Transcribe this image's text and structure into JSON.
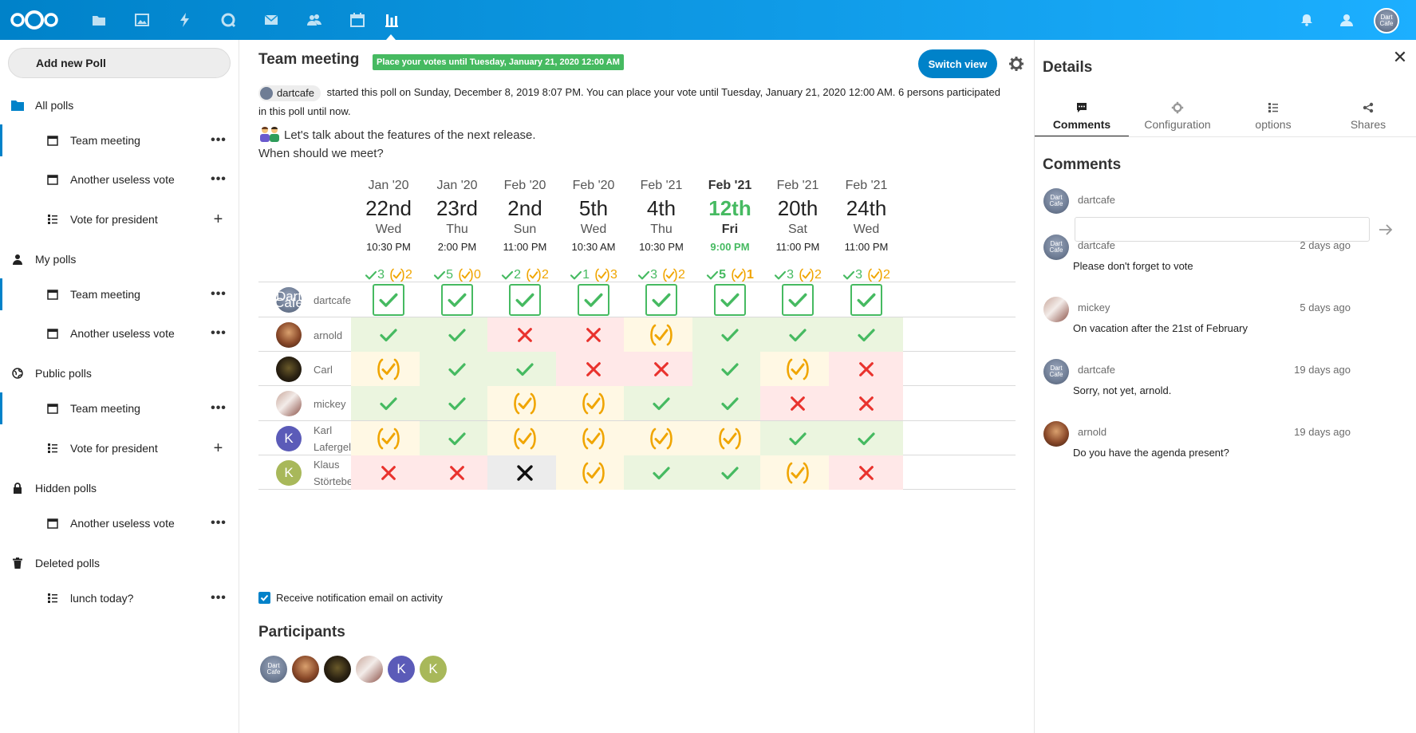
{
  "header": {
    "app_icons": [
      "files-icon",
      "photos-icon",
      "activity-icon",
      "talk-icon",
      "mail-icon",
      "contacts-icon",
      "calendar-icon",
      "polls-icon"
    ],
    "right_icons": [
      "notifications-icon",
      "contacts-menu-icon"
    ]
  },
  "sidebar": {
    "add_label": "Add new Poll",
    "groups": {
      "all": "All polls",
      "my": "My polls",
      "public": "Public polls",
      "hidden": "Hidden polls",
      "deleted": "Deleted polls"
    },
    "items": [
      {
        "label": "Team meeting",
        "icon": "calendar-icon",
        "action": "more"
      },
      {
        "label": "Another useless vote",
        "icon": "calendar-icon",
        "action": "more"
      },
      {
        "label": "Vote for president",
        "icon": "list-icon",
        "action": "add"
      },
      {
        "label": "Team meeting",
        "icon": "calendar-icon",
        "action": "more"
      },
      {
        "label": "Another useless vote",
        "icon": "calendar-icon",
        "action": "more"
      },
      {
        "label": "Team meeting",
        "icon": "calendar-icon",
        "action": "more"
      },
      {
        "label": "Vote for president",
        "icon": "list-icon",
        "action": "add"
      },
      {
        "label": "Another useless vote",
        "icon": "calendar-icon",
        "action": "more"
      },
      {
        "label": "lunch today?",
        "icon": "list-icon",
        "action": "more"
      }
    ]
  },
  "main": {
    "title": "Team meeting",
    "expire_badge": "Place your votes until Tuesday, January 21, 2020 12:00 AM",
    "switch_view": "Switch view",
    "owner": "dartcafe",
    "info_text": "started this poll on Sunday, December 8, 2019 8:07 PM. You can place your vote until Tuesday, January 21, 2020 12:00 AM. 6 persons participated in this poll until now.",
    "desc_line1": "Let's talk about the features of the next release.",
    "desc_line2": "When should we meet?",
    "notify_label": "Receive notification email on activity",
    "participants_title": "Participants"
  },
  "options": [
    {
      "month": "Jan '20",
      "day": "22nd",
      "dow": "Wed",
      "time": "10:30 PM",
      "yes": "3",
      "maybe": "2",
      "best": false
    },
    {
      "month": "Jan '20",
      "day": "23rd",
      "dow": "Thu",
      "time": "2:00 PM",
      "yes": "5",
      "maybe": "0",
      "best": false
    },
    {
      "month": "Feb '20",
      "day": "2nd",
      "dow": "Sun",
      "time": "11:00 PM",
      "yes": "2",
      "maybe": "2",
      "best": false
    },
    {
      "month": "Feb '20",
      "day": "5th",
      "dow": "Wed",
      "time": "10:30 AM",
      "yes": "1",
      "maybe": "3",
      "best": false
    },
    {
      "month": "Feb '21",
      "day": "4th",
      "dow": "Thu",
      "time": "10:30 PM",
      "yes": "3",
      "maybe": "2",
      "best": false
    },
    {
      "month": "Feb '21",
      "day": "12th",
      "dow": "Fri",
      "time": "9:00 PM",
      "yes": "5",
      "maybe": "1",
      "best": true
    },
    {
      "month": "Feb '21",
      "day": "20th",
      "dow": "Sat",
      "time": "11:00 PM",
      "yes": "3",
      "maybe": "2",
      "best": false
    },
    {
      "month": "Feb '21",
      "day": "24th",
      "dow": "Wed",
      "time": "11:00 PM",
      "yes": "3",
      "maybe": "2",
      "best": false
    }
  ],
  "participants": [
    {
      "name": "dartcafe",
      "avatar": "dart",
      "avatar_text": "Dart Cafe",
      "votes": [
        "box",
        "box",
        "box",
        "box",
        "box",
        "box",
        "box",
        "box"
      ]
    },
    {
      "name": "arnold",
      "avatar": "photo-a",
      "votes": [
        "yes",
        "yes",
        "no",
        "no",
        "maybe",
        "yes",
        "yes",
        "yes"
      ]
    },
    {
      "name": "Carl",
      "avatar": "photo-c",
      "votes": [
        "maybe",
        "yes",
        "yes",
        "no",
        "no",
        "yes",
        "maybe",
        "no"
      ]
    },
    {
      "name": "mickey",
      "avatar": "photo-m",
      "votes": [
        "yes",
        "yes",
        "maybe",
        "maybe",
        "yes",
        "yes",
        "no",
        "no"
      ]
    },
    {
      "name": "Karl Lafergeld",
      "avatar": "letter",
      "letter": "K",
      "color": "#5b5bb8",
      "votes": [
        "maybe",
        "yes",
        "maybe",
        "maybe",
        "maybe",
        "maybe",
        "yes",
        "yes"
      ]
    },
    {
      "name": "Klaus Störtebecker",
      "avatar": "letter",
      "letter": "K",
      "color": "#a8b85a",
      "votes": [
        "no",
        "no",
        "none",
        "maybe",
        "yes",
        "yes",
        "maybe",
        "no"
      ]
    }
  ],
  "details": {
    "title": "Details",
    "tabs": [
      {
        "label": "Comments",
        "icon": "comment-icon"
      },
      {
        "label": "Configuration",
        "icon": "gear-icon"
      },
      {
        "label": "options",
        "icon": "list-icon"
      },
      {
        "label": "Shares",
        "icon": "share-icon"
      }
    ],
    "comments_title": "Comments",
    "current_user": "dartcafe",
    "comment_input_value": "",
    "comments": [
      {
        "author": "dartcafe",
        "time": "2 days ago",
        "text": "Please don't forget to vote",
        "avatar": "dart"
      },
      {
        "author": "mickey",
        "time": "5 days ago",
        "text": "On vacation after the 21st of February",
        "avatar": "photo-m"
      },
      {
        "author": "dartcafe",
        "time": "19 days ago",
        "text": "Sorry, not yet, arnold.",
        "avatar": "dart"
      },
      {
        "author": "arnold",
        "time": "19 days ago",
        "text": "Do you have the agenda present?",
        "avatar": "photo-a"
      }
    ]
  },
  "colors": {
    "brand": "#0082c9",
    "yes": "#46ba61",
    "no": "#e9322d",
    "maybe": "#f0a500"
  }
}
